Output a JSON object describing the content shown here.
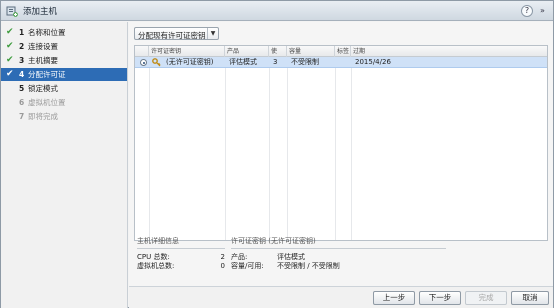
{
  "window": {
    "title": "添加主机",
    "help_label": "?",
    "expand_label": "»"
  },
  "steps": [
    {
      "num": "1",
      "label": "名称和位置",
      "state": "done"
    },
    {
      "num": "2",
      "label": "连接设置",
      "state": "done"
    },
    {
      "num": "3",
      "label": "主机摘要",
      "state": "done"
    },
    {
      "num": "4",
      "label": "分配许可证",
      "state": "active"
    },
    {
      "num": "5",
      "label": "锁定模式",
      "state": "pending"
    },
    {
      "num": "6",
      "label": "虚拟机位置",
      "state": "disabled"
    },
    {
      "num": "7",
      "label": "即将完成",
      "state": "disabled"
    }
  ],
  "license_dropdown": {
    "value": "分配现有许可证密钥"
  },
  "grid": {
    "columns": [
      "许可证密钥",
      "产品",
      "使",
      "容量",
      "标签",
      "过期"
    ],
    "rows": [
      {
        "key": "(无许可证密钥)",
        "product": "评估模式",
        "usage": "3",
        "capacity": "不受限制",
        "labels": "",
        "expires": "2015/4/26",
        "selected": true
      }
    ]
  },
  "host_details": {
    "title": "主机详细信息",
    "items": [
      {
        "k": "CPU 总数:",
        "v": "2"
      },
      {
        "k": "虚拟机总数:",
        "v": "0"
      }
    ]
  },
  "license_details": {
    "title": "许可证密钥 (无许可证密钥)",
    "items": [
      {
        "k": "产品:",
        "v": "评估模式"
      },
      {
        "k": "容量/可用:",
        "v": "不受限制 / 不受限制"
      }
    ]
  },
  "buttons": {
    "back": "上一步",
    "next": "下一步",
    "finish": "完成",
    "cancel": "取消"
  },
  "colors": {
    "active_step": "#2d6cb5",
    "selected_row": "#cfe1f7",
    "check": "#3d9b3d"
  }
}
